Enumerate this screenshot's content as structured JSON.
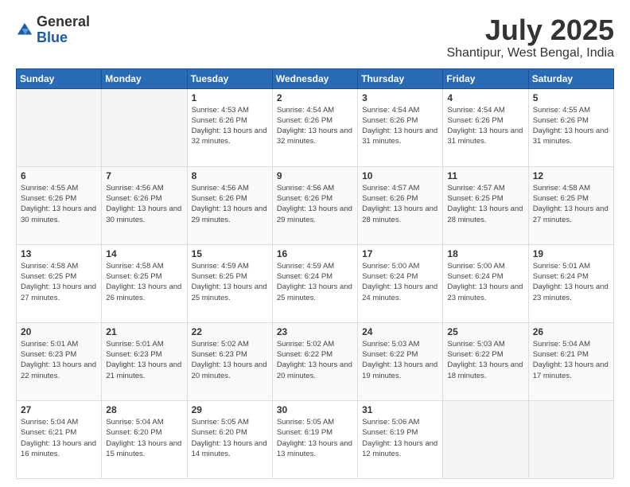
{
  "header": {
    "logo": {
      "general": "General",
      "blue": "Blue"
    },
    "title": "July 2025",
    "location": "Shantipur, West Bengal, India"
  },
  "calendar": {
    "days_header": [
      "Sunday",
      "Monday",
      "Tuesday",
      "Wednesday",
      "Thursday",
      "Friday",
      "Saturday"
    ],
    "weeks": [
      [
        {
          "day": "",
          "sunrise": "",
          "sunset": "",
          "daylight": ""
        },
        {
          "day": "",
          "sunrise": "",
          "sunset": "",
          "daylight": ""
        },
        {
          "day": "1",
          "sunrise": "Sunrise: 4:53 AM",
          "sunset": "Sunset: 6:26 PM",
          "daylight": "Daylight: 13 hours and 32 minutes."
        },
        {
          "day": "2",
          "sunrise": "Sunrise: 4:54 AM",
          "sunset": "Sunset: 6:26 PM",
          "daylight": "Daylight: 13 hours and 32 minutes."
        },
        {
          "day": "3",
          "sunrise": "Sunrise: 4:54 AM",
          "sunset": "Sunset: 6:26 PM",
          "daylight": "Daylight: 13 hours and 31 minutes."
        },
        {
          "day": "4",
          "sunrise": "Sunrise: 4:54 AM",
          "sunset": "Sunset: 6:26 PM",
          "daylight": "Daylight: 13 hours and 31 minutes."
        },
        {
          "day": "5",
          "sunrise": "Sunrise: 4:55 AM",
          "sunset": "Sunset: 6:26 PM",
          "daylight": "Daylight: 13 hours and 31 minutes."
        }
      ],
      [
        {
          "day": "6",
          "sunrise": "Sunrise: 4:55 AM",
          "sunset": "Sunset: 6:26 PM",
          "daylight": "Daylight: 13 hours and 30 minutes."
        },
        {
          "day": "7",
          "sunrise": "Sunrise: 4:56 AM",
          "sunset": "Sunset: 6:26 PM",
          "daylight": "Daylight: 13 hours and 30 minutes."
        },
        {
          "day": "8",
          "sunrise": "Sunrise: 4:56 AM",
          "sunset": "Sunset: 6:26 PM",
          "daylight": "Daylight: 13 hours and 29 minutes."
        },
        {
          "day": "9",
          "sunrise": "Sunrise: 4:56 AM",
          "sunset": "Sunset: 6:26 PM",
          "daylight": "Daylight: 13 hours and 29 minutes."
        },
        {
          "day": "10",
          "sunrise": "Sunrise: 4:57 AM",
          "sunset": "Sunset: 6:26 PM",
          "daylight": "Daylight: 13 hours and 28 minutes."
        },
        {
          "day": "11",
          "sunrise": "Sunrise: 4:57 AM",
          "sunset": "Sunset: 6:25 PM",
          "daylight": "Daylight: 13 hours and 28 minutes."
        },
        {
          "day": "12",
          "sunrise": "Sunrise: 4:58 AM",
          "sunset": "Sunset: 6:25 PM",
          "daylight": "Daylight: 13 hours and 27 minutes."
        }
      ],
      [
        {
          "day": "13",
          "sunrise": "Sunrise: 4:58 AM",
          "sunset": "Sunset: 6:25 PM",
          "daylight": "Daylight: 13 hours and 27 minutes."
        },
        {
          "day": "14",
          "sunrise": "Sunrise: 4:58 AM",
          "sunset": "Sunset: 6:25 PM",
          "daylight": "Daylight: 13 hours and 26 minutes."
        },
        {
          "day": "15",
          "sunrise": "Sunrise: 4:59 AM",
          "sunset": "Sunset: 6:25 PM",
          "daylight": "Daylight: 13 hours and 25 minutes."
        },
        {
          "day": "16",
          "sunrise": "Sunrise: 4:59 AM",
          "sunset": "Sunset: 6:24 PM",
          "daylight": "Daylight: 13 hours and 25 minutes."
        },
        {
          "day": "17",
          "sunrise": "Sunrise: 5:00 AM",
          "sunset": "Sunset: 6:24 PM",
          "daylight": "Daylight: 13 hours and 24 minutes."
        },
        {
          "day": "18",
          "sunrise": "Sunrise: 5:00 AM",
          "sunset": "Sunset: 6:24 PM",
          "daylight": "Daylight: 13 hours and 23 minutes."
        },
        {
          "day": "19",
          "sunrise": "Sunrise: 5:01 AM",
          "sunset": "Sunset: 6:24 PM",
          "daylight": "Daylight: 13 hours and 23 minutes."
        }
      ],
      [
        {
          "day": "20",
          "sunrise": "Sunrise: 5:01 AM",
          "sunset": "Sunset: 6:23 PM",
          "daylight": "Daylight: 13 hours and 22 minutes."
        },
        {
          "day": "21",
          "sunrise": "Sunrise: 5:01 AM",
          "sunset": "Sunset: 6:23 PM",
          "daylight": "Daylight: 13 hours and 21 minutes."
        },
        {
          "day": "22",
          "sunrise": "Sunrise: 5:02 AM",
          "sunset": "Sunset: 6:23 PM",
          "daylight": "Daylight: 13 hours and 20 minutes."
        },
        {
          "day": "23",
          "sunrise": "Sunrise: 5:02 AM",
          "sunset": "Sunset: 6:22 PM",
          "daylight": "Daylight: 13 hours and 20 minutes."
        },
        {
          "day": "24",
          "sunrise": "Sunrise: 5:03 AM",
          "sunset": "Sunset: 6:22 PM",
          "daylight": "Daylight: 13 hours and 19 minutes."
        },
        {
          "day": "25",
          "sunrise": "Sunrise: 5:03 AM",
          "sunset": "Sunset: 6:22 PM",
          "daylight": "Daylight: 13 hours and 18 minutes."
        },
        {
          "day": "26",
          "sunrise": "Sunrise: 5:04 AM",
          "sunset": "Sunset: 6:21 PM",
          "daylight": "Daylight: 13 hours and 17 minutes."
        }
      ],
      [
        {
          "day": "27",
          "sunrise": "Sunrise: 5:04 AM",
          "sunset": "Sunset: 6:21 PM",
          "daylight": "Daylight: 13 hours and 16 minutes."
        },
        {
          "day": "28",
          "sunrise": "Sunrise: 5:04 AM",
          "sunset": "Sunset: 6:20 PM",
          "daylight": "Daylight: 13 hours and 15 minutes."
        },
        {
          "day": "29",
          "sunrise": "Sunrise: 5:05 AM",
          "sunset": "Sunset: 6:20 PM",
          "daylight": "Daylight: 13 hours and 14 minutes."
        },
        {
          "day": "30",
          "sunrise": "Sunrise: 5:05 AM",
          "sunset": "Sunset: 6:19 PM",
          "daylight": "Daylight: 13 hours and 13 minutes."
        },
        {
          "day": "31",
          "sunrise": "Sunrise: 5:06 AM",
          "sunset": "Sunset: 6:19 PM",
          "daylight": "Daylight: 13 hours and 12 minutes."
        },
        {
          "day": "",
          "sunrise": "",
          "sunset": "",
          "daylight": ""
        },
        {
          "day": "",
          "sunrise": "",
          "sunset": "",
          "daylight": ""
        }
      ]
    ]
  }
}
